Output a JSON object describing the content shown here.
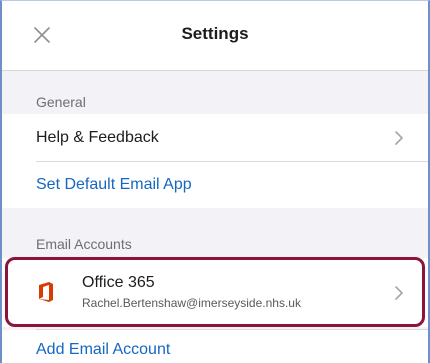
{
  "header": {
    "title": "Settings"
  },
  "general": {
    "section_label": "General",
    "help_feedback_label": "Help & Feedback",
    "set_default_email_label": "Set Default Email App"
  },
  "email_accounts": {
    "section_label": "Email Accounts",
    "accounts": [
      {
        "name": "Office 365",
        "email": "Rachel.Bertenshaw@imerseyside.nhs.uk",
        "icon": "office-365-icon"
      }
    ],
    "add_account_label": "Add Email Account"
  },
  "colors": {
    "link_blue": "#1467c2",
    "highlight_border": "#8a1538",
    "office_orange": "#d83b01",
    "background_grey": "#f2f2f7"
  }
}
